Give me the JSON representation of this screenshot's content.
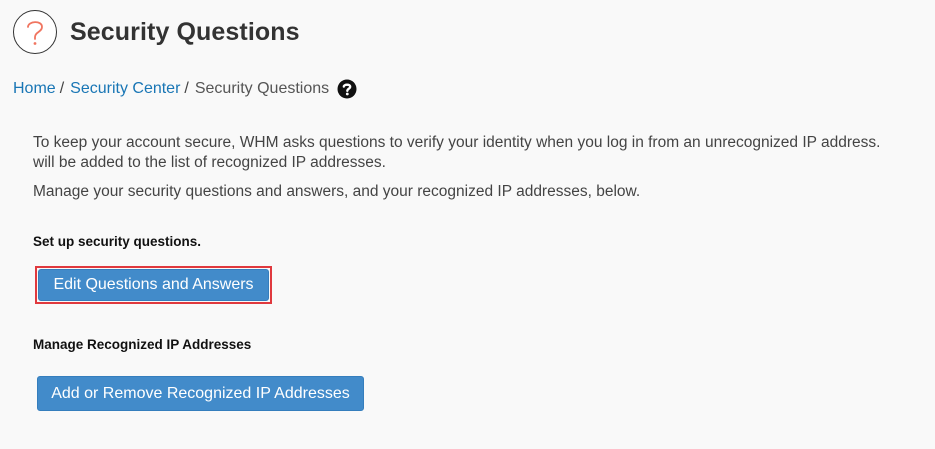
{
  "header": {
    "title": "Security Questions",
    "icon": "question-mark-icon"
  },
  "breadcrumb": {
    "home": "Home",
    "separator": "/",
    "security_center": "Security Center",
    "current": "Security Questions",
    "help_icon": "help-circle-icon"
  },
  "intro": {
    "line1": "To keep your account secure, WHM asks questions to verify your identity when you log in from an unrecognized IP address.",
    "line2": "will be added to the list of recognized IP addresses.",
    "line3": "Manage your security questions and answers, and your recognized IP addresses, below."
  },
  "setup_section": {
    "label": "Set up security questions.",
    "button": "Edit Questions and Answers"
  },
  "ip_section": {
    "label": "Manage Recognized IP Addresses",
    "button": "Add or Remove Recognized IP Addresses"
  },
  "colors": {
    "link": "#1976b5",
    "button": "#428bca",
    "highlight": "#e0393e",
    "icon_accent": "#f07560"
  }
}
